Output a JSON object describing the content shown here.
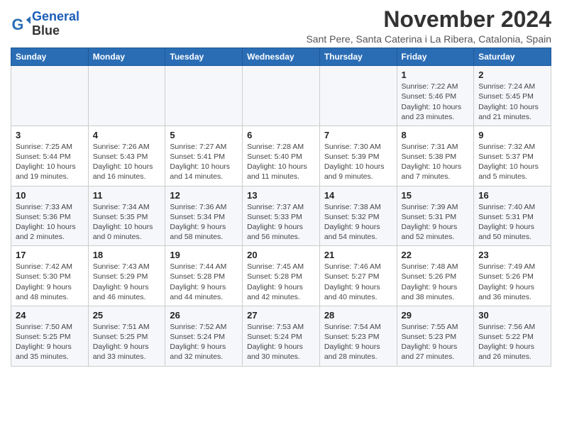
{
  "logo": {
    "line1": "General",
    "line2": "Blue"
  },
  "title": "November 2024",
  "subtitle": "Sant Pere, Santa Caterina i La Ribera, Catalonia, Spain",
  "columns": [
    "Sunday",
    "Monday",
    "Tuesday",
    "Wednesday",
    "Thursday",
    "Friday",
    "Saturday"
  ],
  "weeks": [
    [
      {
        "day": "",
        "info": ""
      },
      {
        "day": "",
        "info": ""
      },
      {
        "day": "",
        "info": ""
      },
      {
        "day": "",
        "info": ""
      },
      {
        "day": "",
        "info": ""
      },
      {
        "day": "1",
        "info": "Sunrise: 7:22 AM\nSunset: 5:46 PM\nDaylight: 10 hours and 23 minutes."
      },
      {
        "day": "2",
        "info": "Sunrise: 7:24 AM\nSunset: 5:45 PM\nDaylight: 10 hours and 21 minutes."
      }
    ],
    [
      {
        "day": "3",
        "info": "Sunrise: 7:25 AM\nSunset: 5:44 PM\nDaylight: 10 hours and 19 minutes."
      },
      {
        "day": "4",
        "info": "Sunrise: 7:26 AM\nSunset: 5:43 PM\nDaylight: 10 hours and 16 minutes."
      },
      {
        "day": "5",
        "info": "Sunrise: 7:27 AM\nSunset: 5:41 PM\nDaylight: 10 hours and 14 minutes."
      },
      {
        "day": "6",
        "info": "Sunrise: 7:28 AM\nSunset: 5:40 PM\nDaylight: 10 hours and 11 minutes."
      },
      {
        "day": "7",
        "info": "Sunrise: 7:30 AM\nSunset: 5:39 PM\nDaylight: 10 hours and 9 minutes."
      },
      {
        "day": "8",
        "info": "Sunrise: 7:31 AM\nSunset: 5:38 PM\nDaylight: 10 hours and 7 minutes."
      },
      {
        "day": "9",
        "info": "Sunrise: 7:32 AM\nSunset: 5:37 PM\nDaylight: 10 hours and 5 minutes."
      }
    ],
    [
      {
        "day": "10",
        "info": "Sunrise: 7:33 AM\nSunset: 5:36 PM\nDaylight: 10 hours and 2 minutes."
      },
      {
        "day": "11",
        "info": "Sunrise: 7:34 AM\nSunset: 5:35 PM\nDaylight: 10 hours and 0 minutes."
      },
      {
        "day": "12",
        "info": "Sunrise: 7:36 AM\nSunset: 5:34 PM\nDaylight: 9 hours and 58 minutes."
      },
      {
        "day": "13",
        "info": "Sunrise: 7:37 AM\nSunset: 5:33 PM\nDaylight: 9 hours and 56 minutes."
      },
      {
        "day": "14",
        "info": "Sunrise: 7:38 AM\nSunset: 5:32 PM\nDaylight: 9 hours and 54 minutes."
      },
      {
        "day": "15",
        "info": "Sunrise: 7:39 AM\nSunset: 5:31 PM\nDaylight: 9 hours and 52 minutes."
      },
      {
        "day": "16",
        "info": "Sunrise: 7:40 AM\nSunset: 5:31 PM\nDaylight: 9 hours and 50 minutes."
      }
    ],
    [
      {
        "day": "17",
        "info": "Sunrise: 7:42 AM\nSunset: 5:30 PM\nDaylight: 9 hours and 48 minutes."
      },
      {
        "day": "18",
        "info": "Sunrise: 7:43 AM\nSunset: 5:29 PM\nDaylight: 9 hours and 46 minutes."
      },
      {
        "day": "19",
        "info": "Sunrise: 7:44 AM\nSunset: 5:28 PM\nDaylight: 9 hours and 44 minutes."
      },
      {
        "day": "20",
        "info": "Sunrise: 7:45 AM\nSunset: 5:28 PM\nDaylight: 9 hours and 42 minutes."
      },
      {
        "day": "21",
        "info": "Sunrise: 7:46 AM\nSunset: 5:27 PM\nDaylight: 9 hours and 40 minutes."
      },
      {
        "day": "22",
        "info": "Sunrise: 7:48 AM\nSunset: 5:26 PM\nDaylight: 9 hours and 38 minutes."
      },
      {
        "day": "23",
        "info": "Sunrise: 7:49 AM\nSunset: 5:26 PM\nDaylight: 9 hours and 36 minutes."
      }
    ],
    [
      {
        "day": "24",
        "info": "Sunrise: 7:50 AM\nSunset: 5:25 PM\nDaylight: 9 hours and 35 minutes."
      },
      {
        "day": "25",
        "info": "Sunrise: 7:51 AM\nSunset: 5:25 PM\nDaylight: 9 hours and 33 minutes."
      },
      {
        "day": "26",
        "info": "Sunrise: 7:52 AM\nSunset: 5:24 PM\nDaylight: 9 hours and 32 minutes."
      },
      {
        "day": "27",
        "info": "Sunrise: 7:53 AM\nSunset: 5:24 PM\nDaylight: 9 hours and 30 minutes."
      },
      {
        "day": "28",
        "info": "Sunrise: 7:54 AM\nSunset: 5:23 PM\nDaylight: 9 hours and 28 minutes."
      },
      {
        "day": "29",
        "info": "Sunrise: 7:55 AM\nSunset: 5:23 PM\nDaylight: 9 hours and 27 minutes."
      },
      {
        "day": "30",
        "info": "Sunrise: 7:56 AM\nSunset: 5:22 PM\nDaylight: 9 hours and 26 minutes."
      }
    ]
  ]
}
